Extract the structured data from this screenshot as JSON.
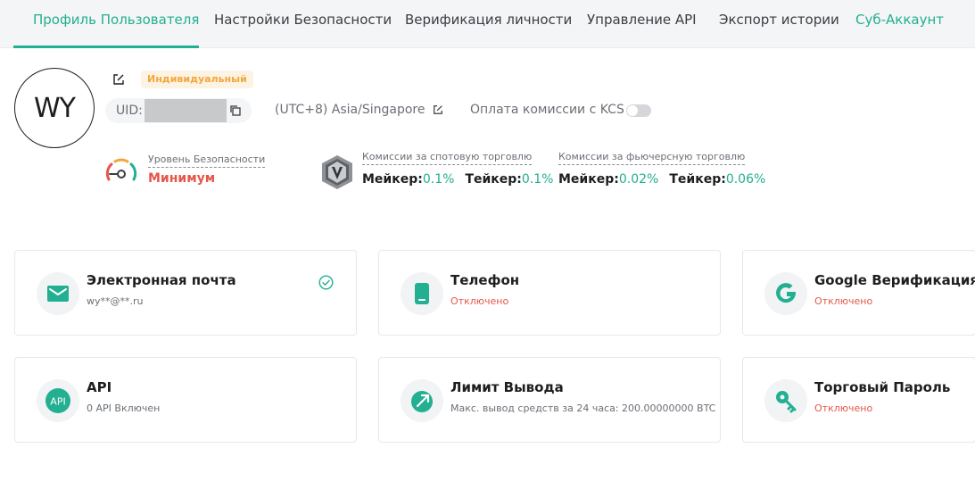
{
  "tabs": [
    {
      "label": "Профиль Пользователя"
    },
    {
      "label": "Настройки Безопасности"
    },
    {
      "label": "Верификация личности"
    },
    {
      "label": "Управление API"
    },
    {
      "label": "Экспорт истории"
    },
    {
      "label": "Суб-Аккаунт"
    }
  ],
  "profile": {
    "avatar_initials": "WY",
    "account_type": "Индивидуальный",
    "uid_label": "UID:",
    "timezone": "(UTC+8) Asia/Singapore",
    "kcs_fee_label": "Оплата комиссии с KCS",
    "kcs_fee_enabled": false
  },
  "security": {
    "label": "Уровень Безопасности",
    "value": "Минимум"
  },
  "spot_fees": {
    "label": "Комиссии за спотовую торговлю",
    "maker_label": "Мейкер:",
    "maker_value": "0.1%",
    "taker_label": "Тейкер:",
    "taker_value": "0.1%"
  },
  "futures_fees": {
    "label": "Комиссии за фьючерсную торговлю",
    "maker_label": "Мейкер:",
    "maker_value": "0.02%",
    "taker_label": "Тейкер:",
    "taker_value": "0.06%"
  },
  "cards": [
    {
      "title": "Электронная почта",
      "subtitle": "wy**@**.ru",
      "verified": true
    },
    {
      "title": "Телефон",
      "subtitle": "Отключено"
    },
    {
      "title": "Google Верификация",
      "subtitle": "Отключено"
    },
    {
      "title": "API",
      "subtitle": "0 API Включен",
      "icon_text": "API"
    },
    {
      "title": "Лимит Вывода",
      "subtitle": "Макс. вывод средств за 24 часа: 200.00000000 BTC"
    },
    {
      "title": "Торговый Пароль",
      "subtitle": "Отключено"
    }
  ],
  "colors": {
    "accent": "#23af91",
    "danger": "#e4574a",
    "warning": "#f3a73b"
  }
}
